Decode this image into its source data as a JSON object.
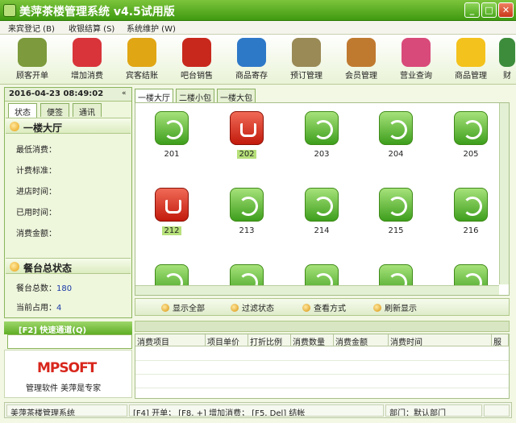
{
  "app": {
    "title": "美萍茶楼管理系统 v4.5试用版",
    "min": "_",
    "max": "□",
    "close": "✕"
  },
  "menus": [
    "来宾登记 (B)",
    "收银结算 (S)",
    "系统维护 (W)"
  ],
  "toolbar": [
    {
      "label": "顾客开单",
      "icon": "tea-cup-icon",
      "color": "#7d9a3c"
    },
    {
      "label": "增加消费",
      "icon": "plus-icon",
      "color": "#d8343a"
    },
    {
      "label": "宾客结账",
      "icon": "money-arrow-icon",
      "color": "#e0a614"
    },
    {
      "label": "吧台销售",
      "icon": "coffee-icon",
      "color": "#c8281c"
    },
    {
      "label": "商品寄存",
      "icon": "basket-icon",
      "color": "#2e78c8"
    },
    {
      "label": "预订管理",
      "icon": "clock-icon",
      "color": "#9a8a56"
    },
    {
      "label": "会员管理",
      "icon": "people-icon",
      "color": "#c07a30"
    },
    {
      "label": "营业查询",
      "icon": "pencil-icon",
      "color": "#d84a7a"
    },
    {
      "label": "商品管理",
      "icon": "star-icon",
      "color": "#f4c21c"
    },
    {
      "label": "财",
      "icon": "wallet-icon",
      "color": "#3c8c3c"
    }
  ],
  "left": {
    "datetime": "2016-04-23 08:49:02",
    "tabs": [
      "状态",
      "便签",
      "通讯"
    ],
    "section1": "一楼大厅",
    "fields": [
      {
        "label": "最低消费：",
        "value": ""
      },
      {
        "label": "计费标准：",
        "value": ""
      },
      {
        "label": "进店时间：",
        "value": ""
      },
      {
        "label": "已用时间：",
        "value": ""
      },
      {
        "label": "消费金额：",
        "value": ""
      }
    ],
    "section2": "餐台总状态",
    "totals": [
      {
        "label": "餐台总数：",
        "value": "180"
      },
      {
        "label": "当前占用：",
        "value": "4"
      }
    ],
    "quick": "[F2] 快速通道(Q)",
    "logo": "MPSOFT",
    "slogan": "管理软件  美萍是专家"
  },
  "areas": [
    "一楼大厅",
    "二楼小包",
    "一楼大包"
  ],
  "rooms": [
    {
      "num": "201",
      "busy": false
    },
    {
      "num": "202",
      "busy": true
    },
    {
      "num": "203",
      "busy": false
    },
    {
      "num": "204",
      "busy": false
    },
    {
      "num": "205",
      "busy": false
    },
    {
      "num": "212",
      "busy": true
    },
    {
      "num": "213",
      "busy": false
    },
    {
      "num": "214",
      "busy": false
    },
    {
      "num": "215",
      "busy": false
    },
    {
      "num": "216",
      "busy": false
    },
    {
      "num": "",
      "busy": false
    },
    {
      "num": "",
      "busy": false
    },
    {
      "num": "",
      "busy": false
    },
    {
      "num": "",
      "busy": false
    },
    {
      "num": "",
      "busy": false
    }
  ],
  "actions": [
    "显示全部",
    "过滤状态",
    "查看方式",
    "刷新显示"
  ],
  "columns": [
    "消费项目",
    "项目单价",
    "打折比例",
    "消费数量",
    "消费金额",
    "消费时间",
    "服"
  ],
  "status": {
    "app": "美萍茶楼管理系统",
    "keys": "[F4] 开单； [F8, +] 增加消费； [F5, Del] 结帐",
    "dept": "部门：默认部门"
  }
}
